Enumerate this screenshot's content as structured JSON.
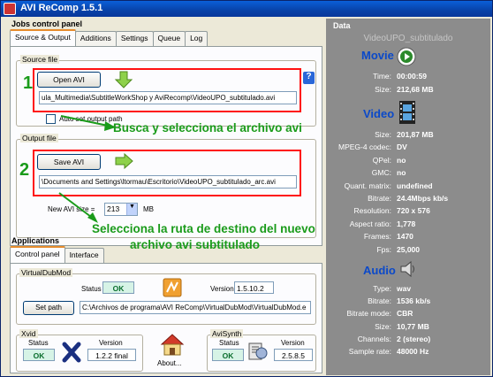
{
  "window": {
    "title": "AVI ReComp  1.5.1"
  },
  "jobs": {
    "title": "Jobs control panel",
    "tabs": [
      "Source & Output",
      "Additions",
      "Settings",
      "Queue",
      "Log"
    ],
    "source": {
      "group_label": "Source file",
      "open_button": "Open AVI",
      "path": "ula_Multimedia\\SubtitleWorkShop y AviRecomp\\VideoUPO_subtitulado.avi",
      "autoset_label": "Auto set output path",
      "help_icon": "help-icon"
    },
    "output": {
      "group_label": "Output file",
      "save_button": "Save AVI",
      "path": "\\Documents and Settings\\ltormau\\Escritorio\\VideoUPO_subtitulado_arc.avi",
      "size_label": "New AVI size =",
      "size_value": "213",
      "size_unit": "MB"
    }
  },
  "annotations": {
    "step1": "1",
    "step2": "2",
    "text1": "Busca y selecciona el archivo avi",
    "text2_line1": "Selecciona la ruta de destino del nuevo",
    "text2_line2": "archivo avi subtitulado",
    "color": "#1a9b1a",
    "box_color": "#ff1010"
  },
  "apps": {
    "title": "Applications",
    "tabs": [
      "Control panel",
      "Interface"
    ],
    "vdm": {
      "group_label": "VirtualDubMod",
      "status_label": "Status",
      "status_value": "OK",
      "version_label": "Version",
      "version_value": "1.5.10.2",
      "setpath_button": "Set path",
      "path": "C:\\Archivos de programa\\AVI ReComp\\VirtualDubMod\\VirtualDubMod.e"
    },
    "xvid": {
      "group_label": "Xvid",
      "status_label": "Status",
      "status_value": "OK",
      "version_label": "Version",
      "version_value": "1.2.2 final"
    },
    "about_label": "About...",
    "avisynth": {
      "group_label": "AviSynth",
      "status_label": "Status",
      "status_value": "OK",
      "version_label": "Version",
      "version_value": "2.5.8.5"
    }
  },
  "data": {
    "title": "Data",
    "filename": "VideoUPO_subtitulado",
    "movie": {
      "heading": "Movie",
      "rows": [
        {
          "k": "Time:",
          "v": "00:00:59"
        },
        {
          "k": "Size:",
          "v": "212,68 MB"
        }
      ]
    },
    "video": {
      "heading": "Video",
      "rows": [
        {
          "k": "Size:",
          "v": "201,87 MB"
        },
        {
          "k": "MPEG-4 codec:",
          "v": "DV"
        },
        {
          "k": "QPel:",
          "v": "no"
        },
        {
          "k": "GMC:",
          "v": "no"
        },
        {
          "k": "Quant. matrix:",
          "v": "undefined"
        },
        {
          "k": "Bitrate:",
          "v": "24.4Mbps kb/s"
        },
        {
          "k": "Resolution:",
          "v": "720 x 576"
        },
        {
          "k": "Aspect ratio:",
          "v": "1,778"
        },
        {
          "k": "Frames:",
          "v": "1470"
        },
        {
          "k": "Fps:",
          "v": "25,000"
        }
      ]
    },
    "audio": {
      "heading": "Audio",
      "rows": [
        {
          "k": "Type:",
          "v": "wav"
        },
        {
          "k": "Bitrate:",
          "v": "1536 kb/s"
        },
        {
          "k": "Bitrate mode:",
          "v": "CBR"
        },
        {
          "k": "Size:",
          "v": "10,77 MB"
        },
        {
          "k": "Channels:",
          "v": "2 (stereo)"
        },
        {
          "k": "Sample rate:",
          "v": "48000 Hz"
        }
      ]
    }
  }
}
